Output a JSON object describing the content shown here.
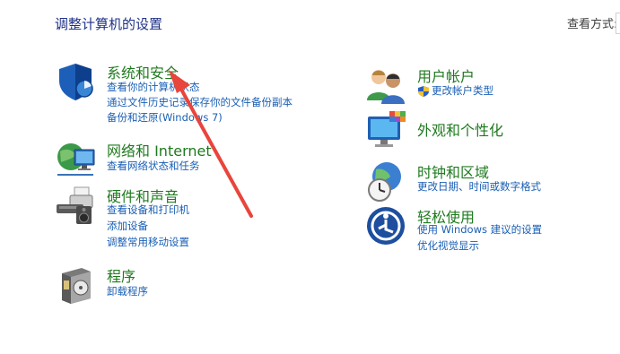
{
  "header": {
    "title": "调整计算机的设置",
    "view_by_label": "查看方式:"
  },
  "left_column": [
    {
      "title": "系统和安全",
      "icon": "shield-icon",
      "links": [
        "查看你的计算机状态",
        "通过文件历史记录保存你的文件备份副本",
        "备份和还原(Windows 7)"
      ]
    },
    {
      "title": "网络和 Internet",
      "icon": "network-globe-icon",
      "links": [
        "查看网络状态和任务"
      ]
    },
    {
      "title": "硬件和声音",
      "icon": "printer-speaker-icon",
      "links": [
        "查看设备和打印机",
        "添加设备",
        "调整常用移动设置"
      ]
    },
    {
      "title": "程序",
      "icon": "programs-box-icon",
      "links": [
        "卸载程序"
      ]
    }
  ],
  "right_column": [
    {
      "title": "用户帐户",
      "icon": "users-icon",
      "links": [
        "更改帐户类型"
      ]
    },
    {
      "title": "外观和个性化",
      "icon": "monitor-palette-icon",
      "links": []
    },
    {
      "title": "时钟和区域",
      "icon": "clock-globe-icon",
      "links": [
        "更改日期、时间或数字格式"
      ]
    },
    {
      "title": "轻松使用",
      "icon": "ease-of-access-icon",
      "links": [
        "使用 Windows 建议的设置",
        "优化视觉显示"
      ]
    }
  ],
  "annotation": {
    "color": "#e8453c"
  }
}
